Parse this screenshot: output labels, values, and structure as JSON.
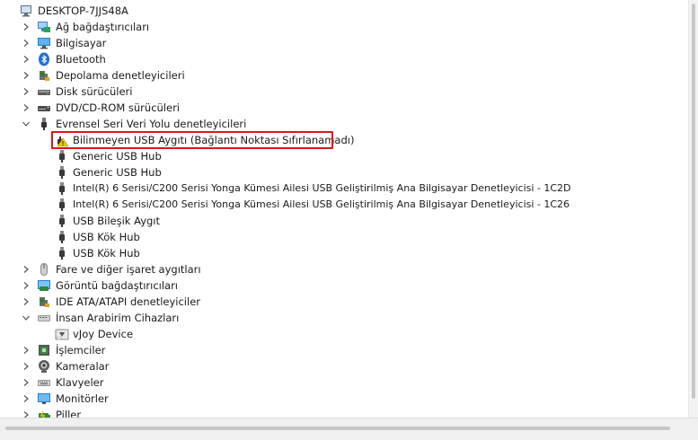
{
  "tree": {
    "root": "DESKTOP-7JJS48A",
    "rows": [
      {
        "label": "Ağ bağdaştırıcıları",
        "icon": "network-adapter-icon"
      },
      {
        "label": "Bilgisayar",
        "icon": "computer-icon"
      },
      {
        "label": "Bluetooth",
        "icon": "bluetooth-icon"
      },
      {
        "label": "Depolama denetleyicileri",
        "icon": "storage-controller-icon"
      },
      {
        "label": "Disk sürücüleri",
        "icon": "disk-drive-icon"
      },
      {
        "label": "DVD/CD-ROM sürücüleri",
        "icon": "dvd-drive-icon"
      },
      {
        "label": "Evrensel Seri Veri Yolu denetleyicileri",
        "icon": "usb-icon",
        "expanded": true
      },
      {
        "label": "Bilinmeyen USB Aygıtı (Bağlantı Noktası Sıfırlanamadı)",
        "icon": "warning-icon"
      },
      {
        "label": "Generic USB Hub",
        "icon": "usb-plug-icon"
      },
      {
        "label": "Generic USB Hub",
        "icon": "usb-plug-icon"
      },
      {
        "label": "Intel(R) 6 Serisi/C200 Serisi Yonga Kümesi Ailesi USB Geliştirilmiş Ana Bilgisayar Denetleyicisi - 1C2D",
        "icon": "usb-plug-icon"
      },
      {
        "label": "Intel(R) 6 Serisi/C200 Serisi Yonga Kümesi Ailesi USB Geliştirilmiş Ana Bilgisayar Denetleyicisi - 1C26",
        "icon": "usb-plug-icon"
      },
      {
        "label": "USB Bileşik Aygıt",
        "icon": "usb-plug-icon"
      },
      {
        "label": "USB Kök Hub",
        "icon": "usb-plug-icon"
      },
      {
        "label": "USB Kök Hub",
        "icon": "usb-plug-icon"
      },
      {
        "label": "Fare ve diğer işaret aygıtları",
        "icon": "mouse-icon"
      },
      {
        "label": "Görüntü bağdaştırıcıları",
        "icon": "display-adapter-icon"
      },
      {
        "label": "IDE ATA/ATAPI denetleyiciler",
        "icon": "ide-controller-icon"
      },
      {
        "label": "İnsan Arabirim Cihazları",
        "icon": "hid-icon",
        "expanded": true
      },
      {
        "label": "vJoy Device",
        "icon": "hid-device-icon"
      },
      {
        "label": "İşlemciler",
        "icon": "processor-icon"
      },
      {
        "label": "Kameralar",
        "icon": "camera-icon"
      },
      {
        "label": "Klavyeler",
        "icon": "keyboard-icon"
      },
      {
        "label": "Monitörler",
        "icon": "monitor-icon"
      },
      {
        "label": "Piller",
        "icon": "battery-icon"
      }
    ]
  },
  "colors": {
    "highlight": "#e0141b",
    "warning": "#f5c400",
    "icon_blue": "#1e88e5"
  }
}
